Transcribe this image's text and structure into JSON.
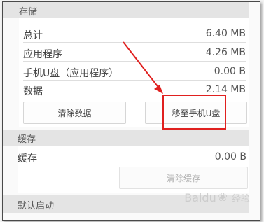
{
  "storage": {
    "header": "存储",
    "rows": [
      {
        "label": "总计",
        "value": "6.40 MB"
      },
      {
        "label": "应用程序",
        "value": "4.26 MB"
      },
      {
        "label": "手机U盘（应用程序）",
        "value": "0.00 B"
      },
      {
        "label": "数据",
        "value": "2.14 MB"
      }
    ],
    "clear_data_button": "清除数据",
    "move_button": "移至手机U盘"
  },
  "cache": {
    "header": "缓存",
    "label": "缓存",
    "value": "0.00 B",
    "clear_cache_button": "清除缓存"
  },
  "default_launch": {
    "header": "默认启动"
  },
  "annotation": {
    "color": "#e0201f"
  },
  "watermark": {
    "text": "Baidu",
    "suffix": "经验"
  }
}
